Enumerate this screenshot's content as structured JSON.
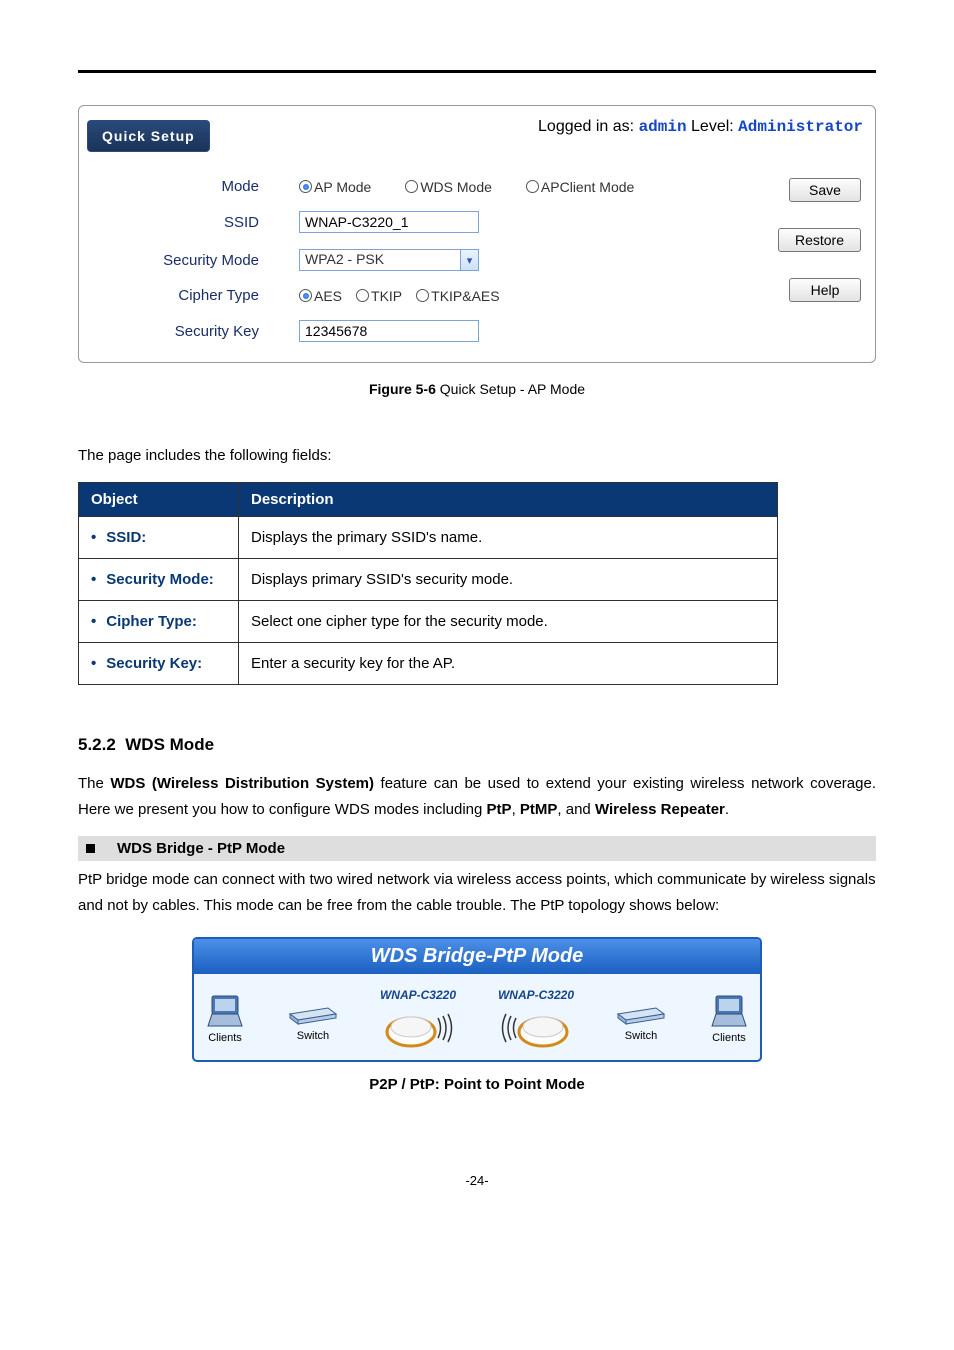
{
  "panel": {
    "tab": "Quick Setup",
    "login_prefix": "Logged in as: ",
    "login_user": "admin",
    "level_prefix": " Level: ",
    "level": "Administrator",
    "labels": {
      "mode": "Mode",
      "ssid": "SSID",
      "security_mode": "Security Mode",
      "cipher_type": "Cipher Type",
      "security_key": "Security Key"
    },
    "mode_options": {
      "ap": "AP Mode",
      "wds": "WDS Mode",
      "apclient": "APClient Mode"
    },
    "ssid_value": "WNAP-C3220_1",
    "security_mode_value": "WPA2 - PSK",
    "cipher_options": {
      "aes": "AES",
      "tkip": "TKIP",
      "tkip_aes": "TKIP&AES"
    },
    "security_key_value": "12345678",
    "buttons": {
      "save": "Save",
      "restore": "Restore",
      "help": "Help"
    }
  },
  "figure_caption_label": "Figure 5-6 ",
  "figure_caption_text": "Quick Setup - AP Mode",
  "fields_intro": "The page includes the following fields:",
  "table": {
    "headers": {
      "object": "Object",
      "description": "Description"
    },
    "rows": [
      {
        "object": "SSID:",
        "desc": "Displays the primary SSID's name."
      },
      {
        "object": "Security Mode:",
        "desc": "Displays primary SSID's security mode."
      },
      {
        "object": "Cipher Type:",
        "desc": "Select one cipher type for the security mode."
      },
      {
        "object": "Security Key:",
        "desc": "Enter a security key for the AP."
      }
    ]
  },
  "section": {
    "num": "5.2.2",
    "title": "WDS Mode",
    "para_pre": "The ",
    "para_b1": "WDS (Wireless Distribution System)",
    "para_mid": " feature can be used to extend your existing wireless network coverage. Here we present you how to configure WDS modes including ",
    "para_b2": "PtP",
    "para_sep1": ", ",
    "para_b3": "PtMP",
    "para_sep2": ", and ",
    "para_b4": "Wireless Repeater",
    "para_end": "."
  },
  "subhead": "WDS Bridge - PtP Mode",
  "ptp_para": "PtP bridge mode can connect with two wired network via wireless access points, which communicate by wireless signals and not by cables. This mode can be free from the cable trouble. The PtP topology shows below:",
  "diagram": {
    "title": "WDS Bridge-PtP Mode",
    "ap_label": "WNAP-C3220",
    "clients": "Clients",
    "switch": "Switch",
    "caption": "P2P / PtP: Point to Point Mode"
  },
  "page_number": "-24-"
}
